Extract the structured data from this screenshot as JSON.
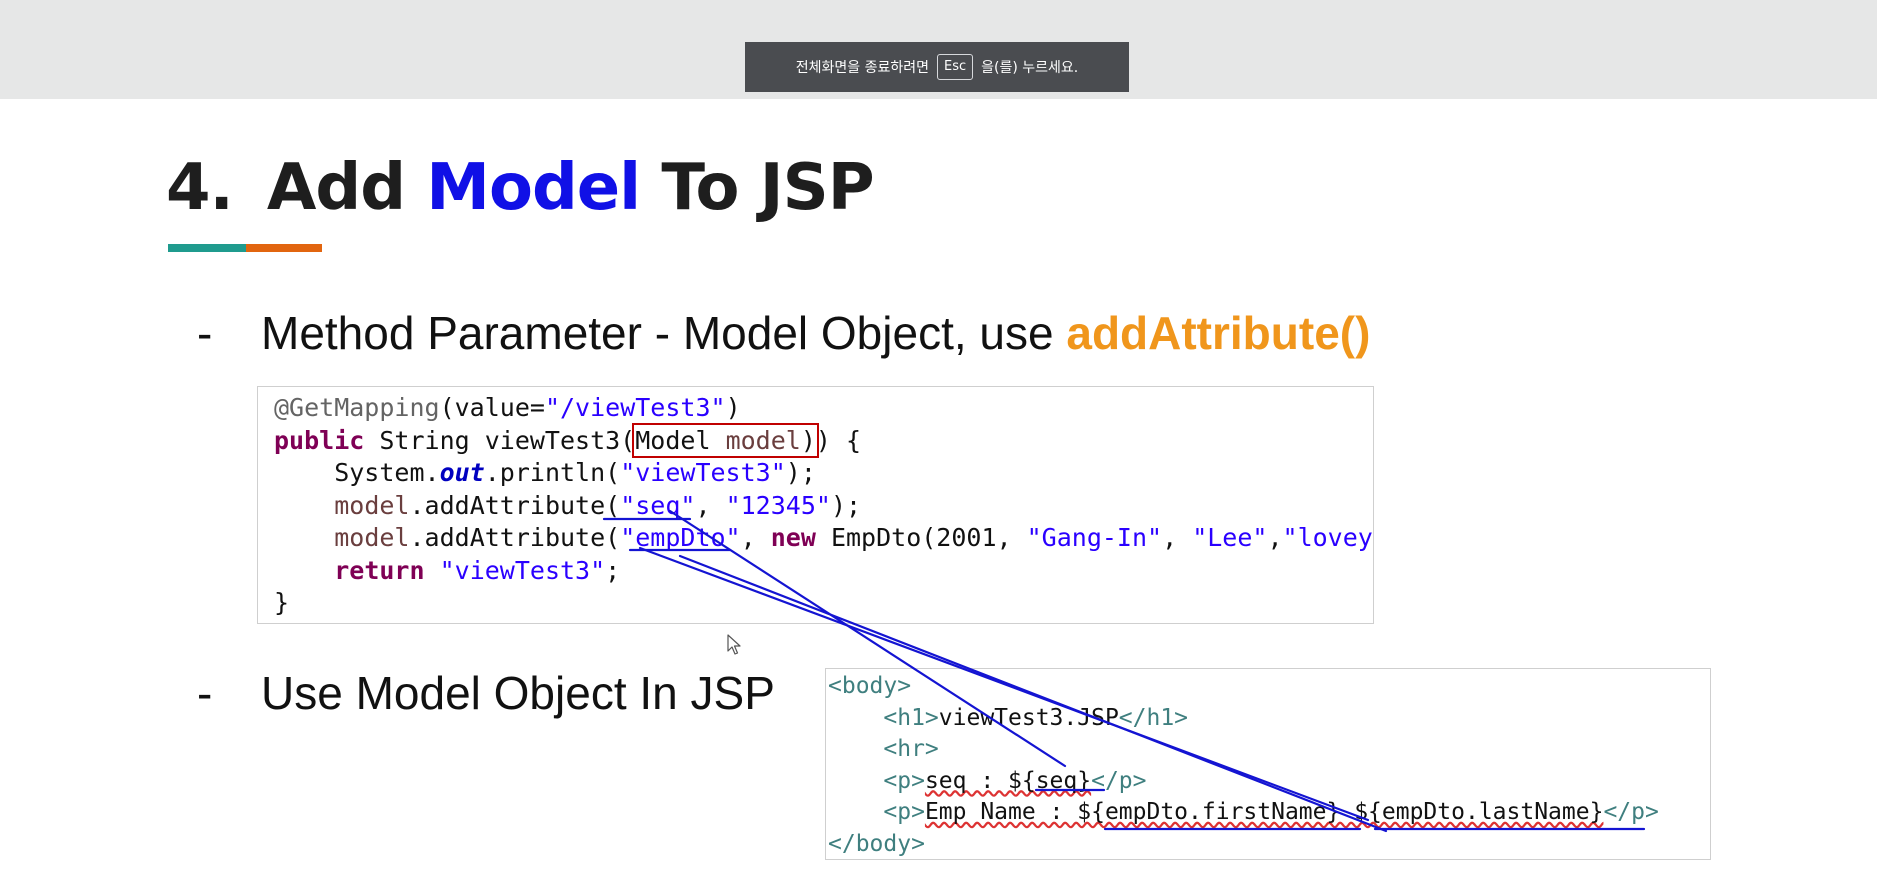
{
  "fullscreen_notice": {
    "before": "전체화면을 종료하려면",
    "key": "Esc",
    "after": "을(를) 누르세요."
  },
  "slide": {
    "title": {
      "number": "4.",
      "part1": "Add",
      "highlight": "Model",
      "part2": "To JSP"
    },
    "bullet1": {
      "dash": "-",
      "text": "Method Parameter - Model Object, use ",
      "accent": "addAttribute()"
    },
    "bullet2": {
      "dash": "-",
      "text": "Use Model Object In JSP"
    },
    "java_code": {
      "l1_ann": "@GetMapping",
      "l1_open": "(value=",
      "l1_str": "\"/viewTest3\"",
      "l1_close": ")",
      "l2_kw": "public",
      "l2_a": " String viewTest3(",
      "l2_type": "Model ",
      "l2_param": "model",
      "l2_b": ") {",
      "l3_a": "    System.",
      "l3_fld": "out",
      "l3_b": ".println(",
      "l3_str": "\"viewTest3\"",
      "l3_c": ");",
      "l4_var": "model",
      "l4_a": ".addAttribute(",
      "l4_str1": "\"seq\"",
      "l4_b": ", ",
      "l4_str2": "\"12345\"",
      "l4_c": ");",
      "l5_var": "model",
      "l5_a": ".addAttribute(",
      "l5_str1": "\"empDto\"",
      "l5_b": ", ",
      "l5_kw": "new",
      "l5_c": " EmpDto(2001, ",
      "l5_str2": "\"Gang-In\"",
      "l5_d": ", ",
      "l5_str3": "\"Lee\"",
      "l5_e": ",",
      "l5_str4": "\"loveyo",
      "l6_kw": "return",
      "l6_str": "\"viewTest3\"",
      "l6_end": ";",
      "l7": "}"
    },
    "jsp_code": {
      "l1": "<body>",
      "l2_open": "<h1>",
      "l2_text": "viewTest3.JSP",
      "l2_close": "</h1>",
      "l3": "<hr>",
      "l4_open": "<p>",
      "l4_text": "seq : ${seq}",
      "l4_close": "</p>",
      "l5_open": "<p>",
      "l5_text": "Emp Name : ${empDto.firstName} ${empDto.lastName}",
      "l5_close": "</p>",
      "l6": "</body>"
    }
  },
  "colors": {
    "title_highlight": "#1010e6",
    "accent_orange": "#f0961c",
    "teal_bar": "#1f9b8e",
    "orange_bar": "#e2650f",
    "annotation_pen": "#1414d2"
  },
  "icons": [
    "mouse-pointer-icon"
  ]
}
